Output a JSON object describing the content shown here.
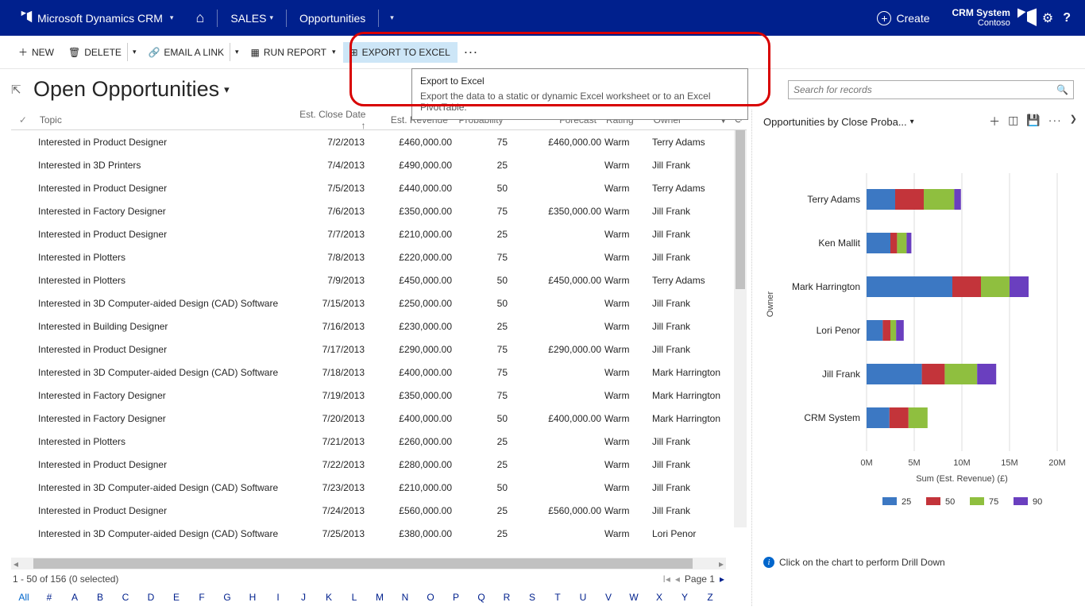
{
  "topbar": {
    "product": "Microsoft Dynamics CRM",
    "area": "SALES",
    "entity": "Opportunities",
    "create": "Create",
    "user_line1": "CRM System",
    "user_line2": "Contoso"
  },
  "cmdbar": {
    "new": "NEW",
    "delete": "DELETE",
    "email": "EMAIL A LINK",
    "run_report": "RUN REPORT",
    "export": "EXPORT TO EXCEL",
    "more": "···"
  },
  "tooltip": {
    "title": "Export to Excel",
    "body": "Export the data to a static or dynamic Excel worksheet or to an Excel PivotTable."
  },
  "view": {
    "title": "Open Opportunities",
    "search_placeholder": "Search for records"
  },
  "grid": {
    "headers": {
      "topic": "Topic",
      "date": "Est. Close Date",
      "rev": "Est. Revenue",
      "prob": "Probability",
      "forecast": "Forecast",
      "rating": "Rating",
      "owner": "Owner"
    },
    "sort_indicator": "↑",
    "rows": [
      {
        "topic": "Interested in Product Designer",
        "date": "7/2/2013",
        "rev": "£460,000.00",
        "prob": "75",
        "forecast": "£460,000.00",
        "rating": "Warm",
        "owner": "Terry Adams"
      },
      {
        "topic": "Interested in 3D Printers",
        "date": "7/4/2013",
        "rev": "£490,000.00",
        "prob": "25",
        "forecast": "",
        "rating": "Warm",
        "owner": "Jill Frank"
      },
      {
        "topic": "Interested in Product Designer",
        "date": "7/5/2013",
        "rev": "£440,000.00",
        "prob": "50",
        "forecast": "",
        "rating": "Warm",
        "owner": "Terry Adams"
      },
      {
        "topic": "Interested in Factory Designer",
        "date": "7/6/2013",
        "rev": "£350,000.00",
        "prob": "75",
        "forecast": "£350,000.00",
        "rating": "Warm",
        "owner": "Jill Frank"
      },
      {
        "topic": "Interested in Product Designer",
        "date": "7/7/2013",
        "rev": "£210,000.00",
        "prob": "25",
        "forecast": "",
        "rating": "Warm",
        "owner": "Jill Frank"
      },
      {
        "topic": "Interested in Plotters",
        "date": "7/8/2013",
        "rev": "£220,000.00",
        "prob": "75",
        "forecast": "",
        "rating": "Warm",
        "owner": "Jill Frank"
      },
      {
        "topic": "Interested in Plotters",
        "date": "7/9/2013",
        "rev": "£450,000.00",
        "prob": "50",
        "forecast": "£450,000.00",
        "rating": "Warm",
        "owner": "Terry Adams"
      },
      {
        "topic": "Interested in 3D Computer-aided Design (CAD) Software",
        "date": "7/15/2013",
        "rev": "£250,000.00",
        "prob": "50",
        "forecast": "",
        "rating": "Warm",
        "owner": "Jill Frank"
      },
      {
        "topic": "Interested in Building Designer",
        "date": "7/16/2013",
        "rev": "£230,000.00",
        "prob": "25",
        "forecast": "",
        "rating": "Warm",
        "owner": "Jill Frank"
      },
      {
        "topic": "Interested in Product Designer",
        "date": "7/17/2013",
        "rev": "£290,000.00",
        "prob": "75",
        "forecast": "£290,000.00",
        "rating": "Warm",
        "owner": "Jill Frank"
      },
      {
        "topic": "Interested in 3D Computer-aided Design (CAD) Software",
        "date": "7/18/2013",
        "rev": "£400,000.00",
        "prob": "75",
        "forecast": "",
        "rating": "Warm",
        "owner": "Mark Harrington"
      },
      {
        "topic": "Interested in Factory Designer",
        "date": "7/19/2013",
        "rev": "£350,000.00",
        "prob": "75",
        "forecast": "",
        "rating": "Warm",
        "owner": "Mark Harrington"
      },
      {
        "topic": "Interested in Factory Designer",
        "date": "7/20/2013",
        "rev": "£400,000.00",
        "prob": "50",
        "forecast": "£400,000.00",
        "rating": "Warm",
        "owner": "Mark Harrington"
      },
      {
        "topic": "Interested in Plotters",
        "date": "7/21/2013",
        "rev": "£260,000.00",
        "prob": "25",
        "forecast": "",
        "rating": "Warm",
        "owner": "Jill Frank"
      },
      {
        "topic": "Interested in Product Designer",
        "date": "7/22/2013",
        "rev": "£280,000.00",
        "prob": "25",
        "forecast": "",
        "rating": "Warm",
        "owner": "Jill Frank"
      },
      {
        "topic": "Interested in 3D Computer-aided Design (CAD) Software",
        "date": "7/23/2013",
        "rev": "£210,000.00",
        "prob": "50",
        "forecast": "",
        "rating": "Warm",
        "owner": "Jill Frank"
      },
      {
        "topic": "Interested in Product Designer",
        "date": "7/24/2013",
        "rev": "£560,000.00",
        "prob": "25",
        "forecast": "£560,000.00",
        "rating": "Warm",
        "owner": "Jill Frank"
      },
      {
        "topic": "Interested in 3D Computer-aided Design (CAD) Software",
        "date": "7/25/2013",
        "rev": "£380,000.00",
        "prob": "25",
        "forecast": "",
        "rating": "Warm",
        "owner": "Lori Penor"
      }
    ]
  },
  "status": {
    "text": "1 - 50 of 156 (0 selected)",
    "page_label": "Page 1"
  },
  "alpha": [
    "All",
    "#",
    "A",
    "B",
    "C",
    "D",
    "E",
    "F",
    "G",
    "H",
    "I",
    "J",
    "K",
    "L",
    "M",
    "N",
    "O",
    "P",
    "Q",
    "R",
    "S",
    "T",
    "U",
    "V",
    "W",
    "X",
    "Y",
    "Z"
  ],
  "chart": {
    "title": "Opportunities by Close Proba...",
    "hint": "Click on the chart to perform Drill Down",
    "xlabel": "Sum (Est. Revenue) (£)",
    "ylabel": "Owner",
    "legend": [
      "25",
      "50",
      "75",
      "90"
    ]
  },
  "chart_data": {
    "type": "bar",
    "orientation": "horizontal",
    "stacked": true,
    "title": "Opportunities by Close Probability",
    "xlabel": "Sum (Est. Revenue) (£)",
    "ylabel": "Owner",
    "x_ticks": [
      "0M",
      "5M",
      "10M",
      "15M",
      "20M"
    ],
    "xlim": [
      0,
      20
    ],
    "categories": [
      "Terry Adams",
      "Ken Mallit",
      "Mark Harrington",
      "Lori Penor",
      "Jill Frank",
      "CRM System"
    ],
    "series": [
      {
        "name": "25",
        "color": "#3c78c3",
        "values": [
          3.0,
          2.5,
          9.0,
          1.7,
          5.8,
          2.4
        ]
      },
      {
        "name": "50",
        "color": "#c3343a",
        "values": [
          3.0,
          0.7,
          3.0,
          0.8,
          2.4,
          2.0
        ]
      },
      {
        "name": "75",
        "color": "#8fbf3f",
        "values": [
          3.2,
          1.0,
          3.0,
          0.6,
          3.4,
          2.0
        ]
      },
      {
        "name": "90",
        "color": "#6a3fbf",
        "values": [
          0.7,
          0.5,
          2.0,
          0.8,
          2.0,
          0.0
        ]
      }
    ],
    "legend_items": [
      {
        "label": "25",
        "color": "#3c78c3"
      },
      {
        "label": "50",
        "color": "#c3343a"
      },
      {
        "label": "75",
        "color": "#8fbf3f"
      },
      {
        "label": "90",
        "color": "#6a3fbf"
      }
    ]
  }
}
